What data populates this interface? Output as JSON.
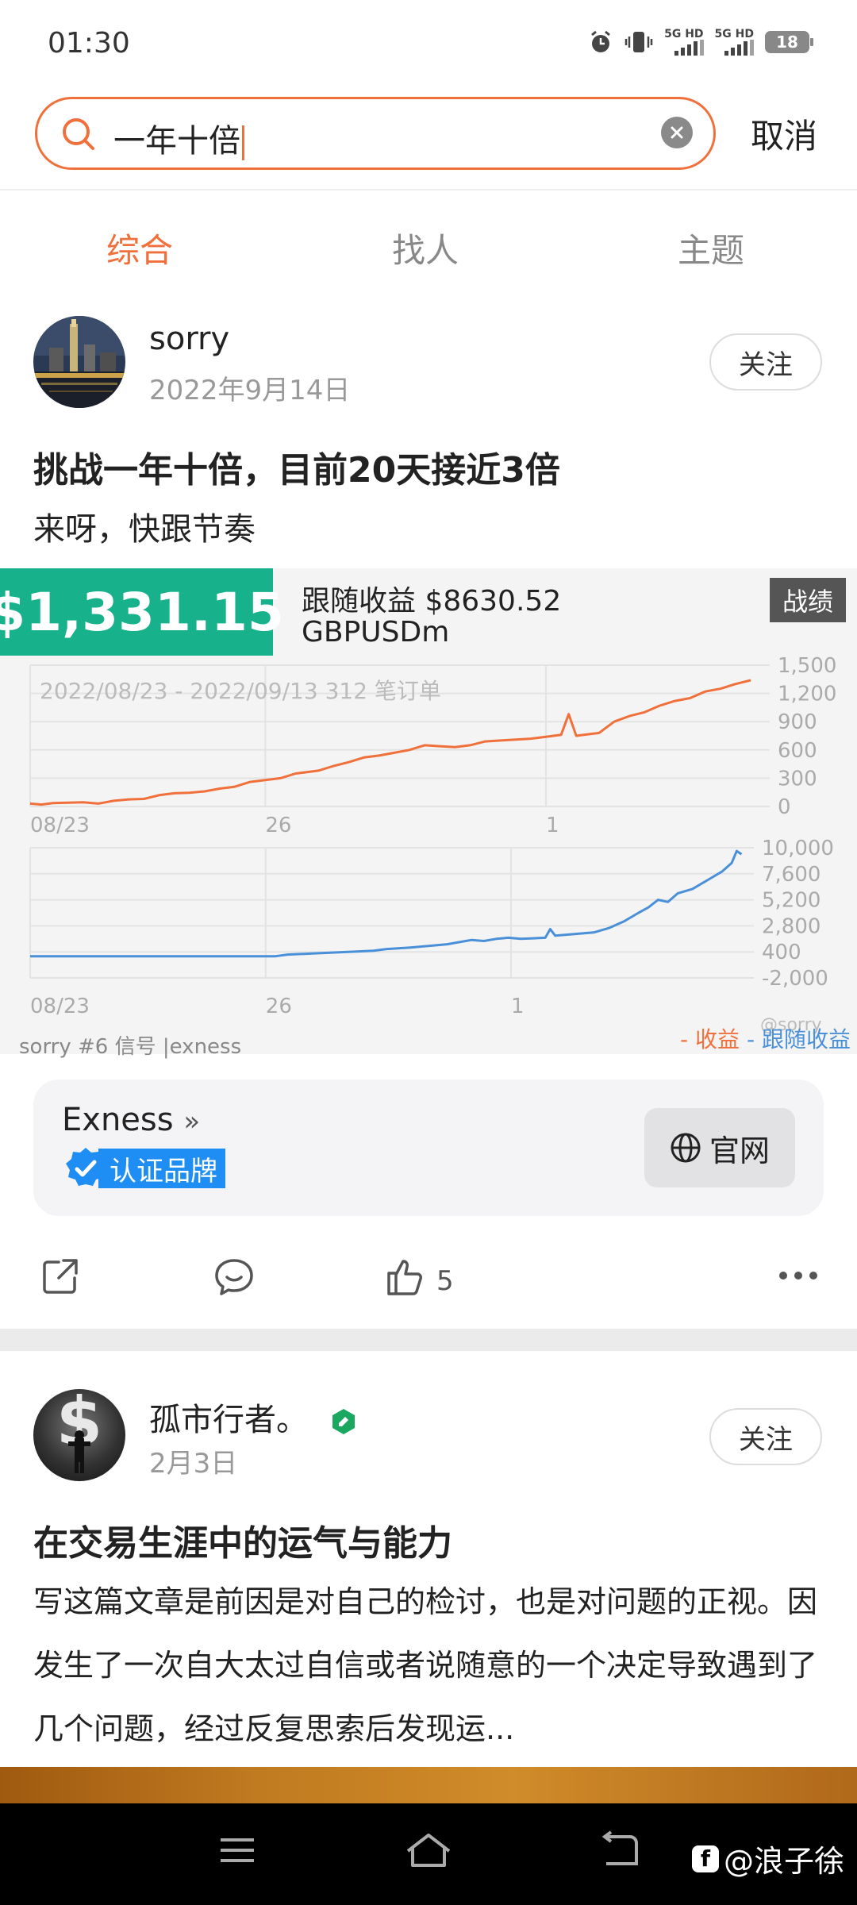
{
  "status_bar": {
    "time": "01:30",
    "sim1": "5G HD",
    "sim2": "5G HD",
    "battery": "18"
  },
  "search": {
    "query": "一年十倍",
    "cancel": "取消"
  },
  "tabs": [
    {
      "label": "综合",
      "active": true
    },
    {
      "label": "找人",
      "active": false
    },
    {
      "label": "主题",
      "active": false
    }
  ],
  "post1": {
    "author": "sorry",
    "date": "2022年9月14日",
    "follow": "关注",
    "title": "挑战一年十倍，目前20天接近3倍",
    "body": "来呀，快跟节奏",
    "card": {
      "balance": "$1,331.15",
      "follow_profit": "跟随收益 $8630.52",
      "symbol": "GBPUSDm",
      "badge": "战绩",
      "footer": "sorry #6 信号 |exness",
      "legend_profit": "收益",
      "legend_follow": "跟随收益",
      "watermark": "@sorry"
    },
    "brand": {
      "name": "Exness",
      "verified": "认证品牌",
      "site": "官网"
    },
    "likes": "5"
  },
  "post2": {
    "author": "孤市行者。",
    "date": "2月3日",
    "follow": "关注",
    "title": "在交易生涯中的运气与能力",
    "body": "写这篇文章是前因是对自己的检讨，也是对问题的正视。因发生了一次自大太过自信或者说随意的一个决定导致遇到了几个问题，经过反复思索后发现运..."
  },
  "nav": {
    "watermark": "@浪子徐"
  },
  "colors": {
    "accent": "#f0703c",
    "green": "#17b28b",
    "blue": "#4a90d9",
    "verified": "#1e8ef5"
  },
  "chart_data": [
    {
      "type": "line",
      "title": "2022/08/23 - 2022/09/13 312 笔订单",
      "x_ticks": [
        "08/23",
        "26",
        "1"
      ],
      "y_ticks": [
        "1,500",
        "1,200",
        "900",
        "600",
        "300",
        "0"
      ],
      "ylim": [
        0,
        1500
      ],
      "series": [
        {
          "name": "收益",
          "color": "#f0703c",
          "points": [
            [
              0,
              30
            ],
            [
              0.03,
              20
            ],
            [
              0.06,
              35
            ],
            [
              0.1,
              40
            ],
            [
              0.14,
              45
            ],
            [
              0.18,
              30
            ],
            [
              0.22,
              60
            ],
            [
              0.26,
              75
            ],
            [
              0.3,
              80
            ],
            [
              0.34,
              120
            ],
            [
              0.38,
              140
            ],
            [
              0.42,
              145
            ],
            [
              0.46,
              160
            ],
            [
              0.5,
              190
            ],
            [
              0.54,
              210
            ],
            [
              0.58,
              260
            ],
            [
              0.62,
              280
            ],
            [
              0.66,
              300
            ],
            [
              0.7,
              350
            ],
            [
              0.74,
              370
            ],
            [
              0.76,
              380
            ],
            [
              0.8,
              430
            ],
            [
              0.84,
              470
            ],
            [
              0.88,
              520
            ],
            [
              0.92,
              540
            ],
            [
              0.96,
              570
            ],
            [
              1.0,
              600
            ],
            [
              1.04,
              650
            ],
            [
              1.08,
              640
            ],
            [
              1.12,
              630
            ],
            [
              1.16,
              650
            ],
            [
              1.2,
              690
            ],
            [
              1.24,
              700
            ],
            [
              1.28,
              710
            ],
            [
              1.32,
              720
            ],
            [
              1.36,
              740
            ],
            [
              1.4,
              760
            ],
            [
              1.42,
              980
            ],
            [
              1.44,
              750
            ],
            [
              1.46,
              760
            ],
            [
              1.5,
              780
            ],
            [
              1.54,
              900
            ],
            [
              1.58,
              960
            ],
            [
              1.62,
              1000
            ],
            [
              1.66,
              1070
            ],
            [
              1.7,
              1120
            ],
            [
              1.74,
              1150
            ],
            [
              1.78,
              1220
            ],
            [
              1.82,
              1250
            ],
            [
              1.86,
              1300
            ],
            [
              1.9,
              1340
            ]
          ]
        }
      ]
    },
    {
      "type": "line",
      "x_ticks": [
        "08/23",
        "26",
        "1"
      ],
      "y_ticks": [
        "10,000",
        "7,600",
        "5,200",
        "2,800",
        "400",
        "-2,000"
      ],
      "ylim": [
        -2000,
        10000
      ],
      "series": [
        {
          "name": "跟随收益",
          "color": "#4a90d9",
          "points": [
            [
              0,
              0
            ],
            [
              0.4,
              0
            ],
            [
              0.8,
              0
            ],
            [
              1.0,
              0
            ],
            [
              1.05,
              150
            ],
            [
              1.15,
              250
            ],
            [
              1.25,
              350
            ],
            [
              1.35,
              450
            ],
            [
              1.4,
              500
            ],
            [
              1.45,
              650
            ],
            [
              1.55,
              800
            ],
            [
              1.65,
              1000
            ],
            [
              1.7,
              1100
            ],
            [
              1.75,
              1300
            ],
            [
              1.8,
              1500
            ],
            [
              1.85,
              1400
            ],
            [
              1.9,
              1600
            ],
            [
              1.95,
              1700
            ],
            [
              2.0,
              1600
            ],
            [
              2.05,
              1650
            ],
            [
              2.1,
              1700
            ],
            [
              2.12,
              2500
            ],
            [
              2.14,
              1900
            ],
            [
              2.2,
              2000
            ],
            [
              2.3,
              2200
            ],
            [
              2.36,
              2600
            ],
            [
              2.42,
              3200
            ],
            [
              2.48,
              4000
            ],
            [
              2.52,
              4500
            ],
            [
              2.56,
              5200
            ],
            [
              2.6,
              5000
            ],
            [
              2.64,
              5800
            ],
            [
              2.7,
              6200
            ],
            [
              2.76,
              7000
            ],
            [
              2.82,
              7800
            ],
            [
              2.86,
              8600
            ],
            [
              2.88,
              9700
            ],
            [
              2.9,
              9400
            ]
          ]
        }
      ]
    }
  ]
}
